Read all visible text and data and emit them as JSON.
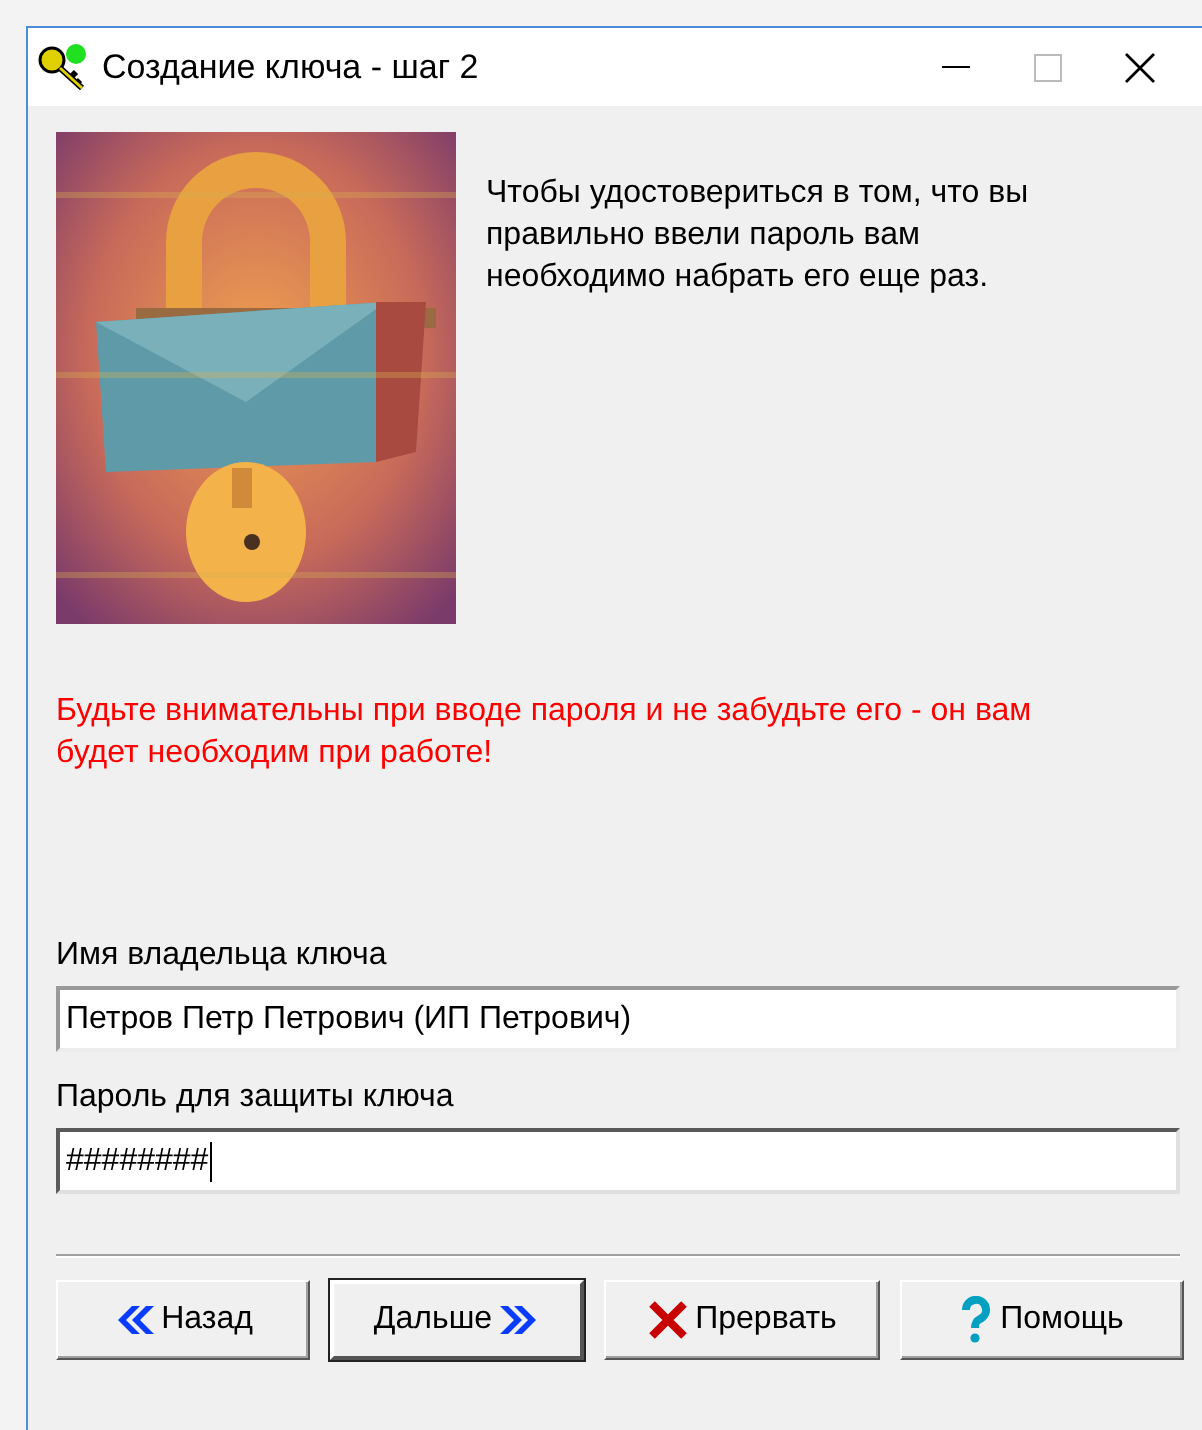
{
  "window": {
    "title": "Создание ключа - шаг 2"
  },
  "intro": "Чтобы удостовериться в том, что вы правильно ввели пароль вам необходимо набрать его еще раз.",
  "warning": "Будьте внимательны при вводе пароля и не забудьте его - он вам будет необходим при работе!",
  "fields": [
    {
      "label": "Имя владельца ключа",
      "value": "Петров Петр Петрович (ИП Петрович)",
      "focused": false
    },
    {
      "label": "Пароль для защиты ключа",
      "value": "########",
      "focused": true
    }
  ],
  "buttons": [
    {
      "label": "Назад",
      "kind": "back",
      "default": false
    },
    {
      "label": "Дальше",
      "kind": "next",
      "default": true
    },
    {
      "label": "Прервать",
      "kind": "cancel",
      "default": false
    },
    {
      "label": "Помощь",
      "kind": "help",
      "default": false
    }
  ]
}
